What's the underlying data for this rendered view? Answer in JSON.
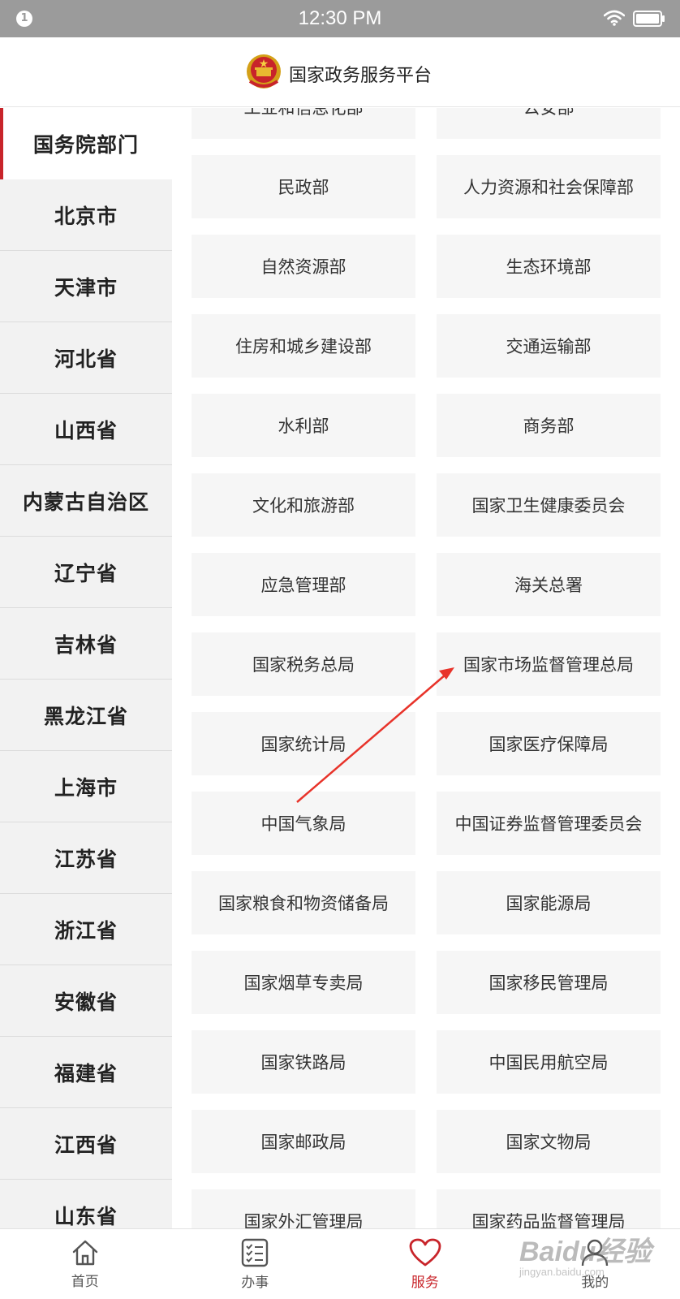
{
  "status_bar": {
    "notification_count": "1",
    "time": "12:30 PM",
    "icons": [
      "wifi-icon",
      "battery-icon"
    ]
  },
  "header": {
    "title": "国家政务服务平台",
    "emblem_icon": "national-emblem-icon"
  },
  "sidebar": {
    "items": [
      {
        "label": "国务院部门",
        "active": true
      },
      {
        "label": "北京市"
      },
      {
        "label": "天津市"
      },
      {
        "label": "河北省"
      },
      {
        "label": "山西省"
      },
      {
        "label": "内蒙古自治区"
      },
      {
        "label": "辽宁省"
      },
      {
        "label": "吉林省"
      },
      {
        "label": "黑龙江省"
      },
      {
        "label": "上海市"
      },
      {
        "label": "江苏省"
      },
      {
        "label": "浙江省"
      },
      {
        "label": "安徽省"
      },
      {
        "label": "福建省"
      },
      {
        "label": "江西省"
      },
      {
        "label": "山东省"
      }
    ]
  },
  "departments": [
    "工业和信息化部",
    "公安部",
    "民政部",
    "人力资源和社会保障部",
    "自然资源部",
    "生态环境部",
    "住房和城乡建设部",
    "交通运输部",
    "水利部",
    "商务部",
    "文化和旅游部",
    "国家卫生健康委员会",
    "应急管理部",
    "海关总署",
    "国家税务总局",
    "国家市场监督管理总局",
    "国家统计局",
    "国家医疗保障局",
    "中国气象局",
    "中国证券监督管理委员会",
    "国家粮食和物资储备局",
    "国家能源局",
    "国家烟草专卖局",
    "国家移民管理局",
    "国家铁路局",
    "中国民用航空局",
    "国家邮政局",
    "国家文物局",
    "国家外汇管理局",
    "国家药品监督管理局"
  ],
  "bottom_nav": {
    "items": [
      {
        "label": "首页",
        "icon": "home-icon"
      },
      {
        "label": "办事",
        "icon": "checklist-icon"
      },
      {
        "label": "服务",
        "icon": "heart-icon",
        "active": true
      },
      {
        "label": "我的",
        "icon": "user-icon"
      }
    ]
  },
  "watermark": {
    "main": "Baidu经验",
    "sub": "jingyan.baidu.com"
  },
  "colors": {
    "accent": "#c8242a",
    "status_bar": "#9b9b9b",
    "sidebar_bg": "#f2f2f2",
    "tile_bg": "#f6f6f6",
    "annotation_arrow": "#e8332a"
  }
}
